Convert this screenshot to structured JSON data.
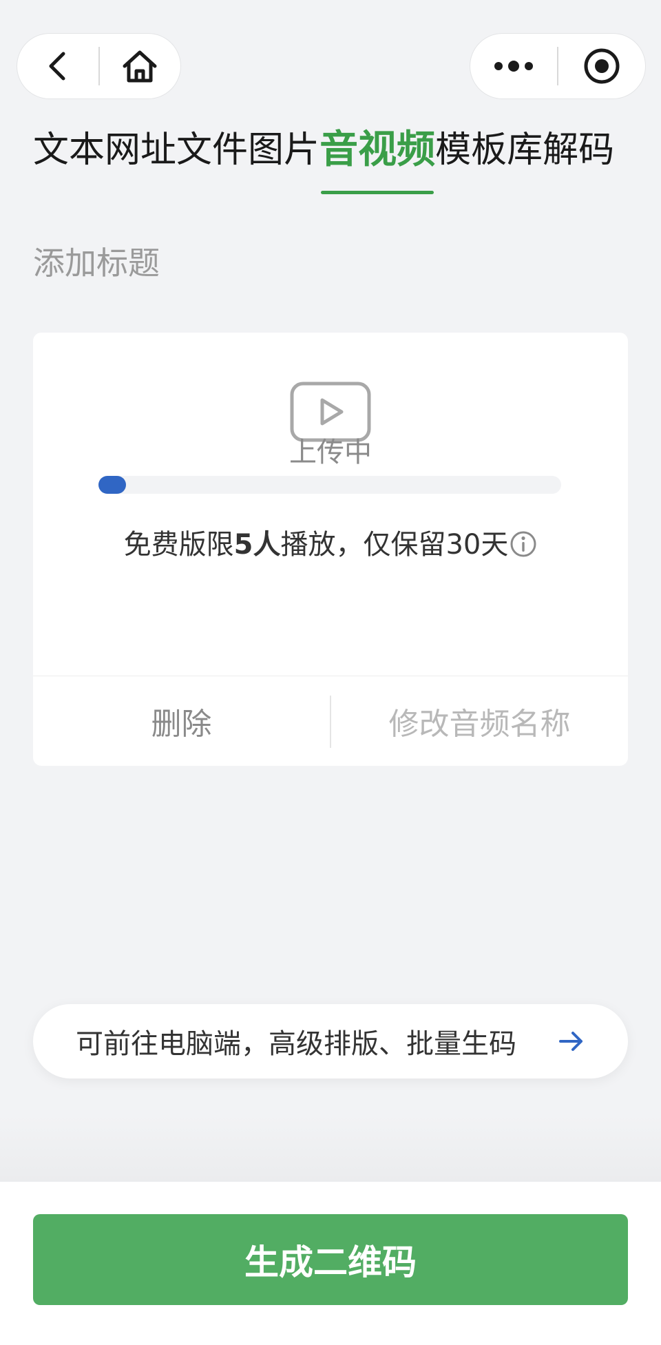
{
  "nav": {
    "back_icon": "chevron-left-icon",
    "home_icon": "home-icon",
    "more_icon": "more-dots-icon",
    "close_icon": "target-circle-icon"
  },
  "tabs": [
    {
      "label": "文本",
      "active": false
    },
    {
      "label": "网址",
      "active": false
    },
    {
      "label": "文件",
      "active": false
    },
    {
      "label": "图片",
      "active": false
    },
    {
      "label": "音视频",
      "active": true
    },
    {
      "label": "模板库",
      "active": false
    },
    {
      "label": "解码",
      "active": false
    }
  ],
  "title_placeholder": "添加标题",
  "upload": {
    "icon": "play-video-icon",
    "progress_fraction": 0.05,
    "status": "上传中",
    "limit_prefix": "免费版限",
    "limit_count": "5人",
    "limit_suffix": "播放，仅保留30天",
    "info_icon": "info-circle-icon",
    "delete_label": "删除",
    "rename_label": "修改音频名称"
  },
  "pc_tip": {
    "text": "可前往电脑端，高级排版、批量生码",
    "arrow_icon": "arrow-right-icon"
  },
  "generate_label": "生成二维码",
  "colors": {
    "accent_green": "#3a9e48",
    "button_green": "#52ad63",
    "progress_blue": "#3066c4"
  }
}
